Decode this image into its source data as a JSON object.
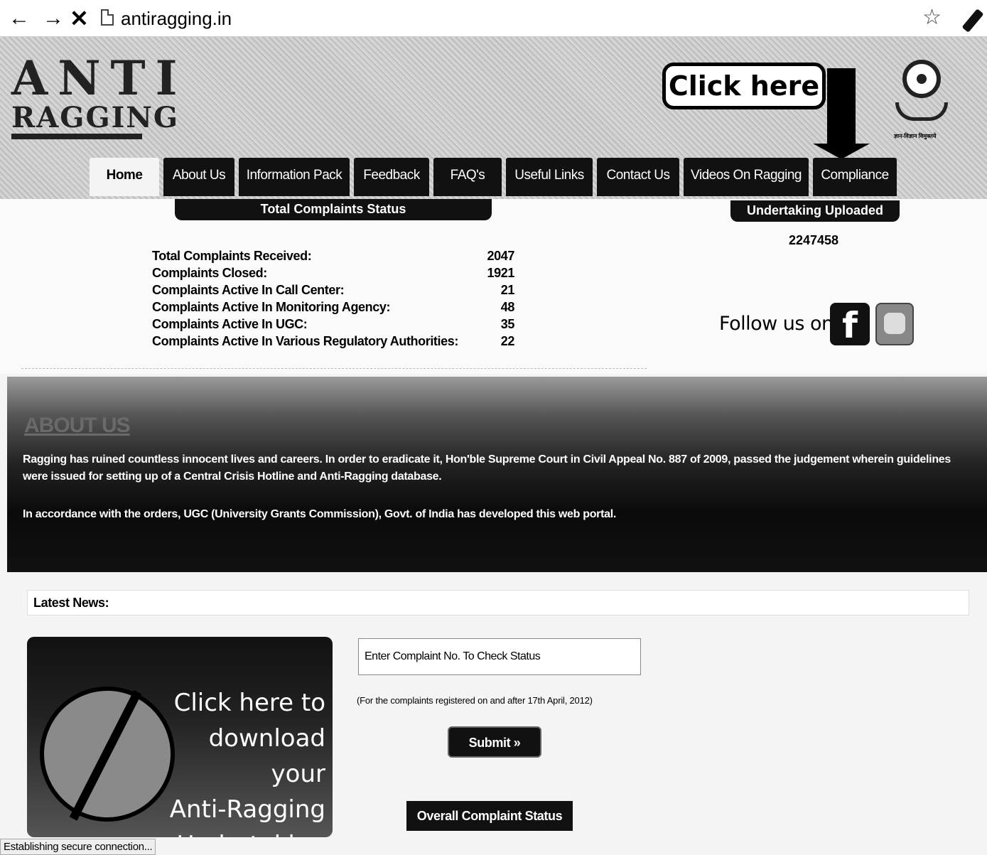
{
  "browser": {
    "url": "antiragging.in",
    "status_text": "Establishing secure connection..."
  },
  "header": {
    "logo_line1": "ANTI",
    "logo_line2": "RAGGING",
    "callout": "Click here",
    "emblem_caption": "ज्ञान-विज्ञान विमुक्तये"
  },
  "menu": [
    "Home",
    "About Us",
    "Information Pack",
    "Feedback",
    "FAQ's",
    "Useful Links",
    "Contact Us",
    "Videos On Ragging",
    "Compliance"
  ],
  "status": {
    "tab_total": "Total Complaints Status",
    "tab_undertaking": "Undertaking Uploaded",
    "undertaking_count": "2247458",
    "rows": [
      {
        "label": "Total Complaints Received:",
        "value": "2047"
      },
      {
        "label": "Complaints Closed:",
        "value": "1921"
      },
      {
        "label": "Complaints Active In Call Center:",
        "value": "21"
      },
      {
        "label": "Complaints Active In Monitoring Agency:",
        "value": "48"
      },
      {
        "label": "Complaints Active In UGC:",
        "value": "35"
      },
      {
        "label": "Complaints Active In Various Regulatory Authorities:",
        "value": "22"
      }
    ],
    "follow_text": "Follow us on",
    "facebook_glyph": "f"
  },
  "about": {
    "title": "ABOUT US",
    "p1": "Ragging has ruined countless innocent lives and careers. In order to eradicate it, Hon'ble Supreme Court in Civil Appeal No. 887 of 2009, passed the judgement wherein guidelines were issued for setting up of a Central Crisis Hotline and Anti-Ragging database.",
    "p2": "In accordance with the orders, UGC (University Grants Commission), Govt. of India has developed this web portal."
  },
  "news": {
    "label": "Latest News:"
  },
  "download": {
    "line1": "Click here to",
    "line2": "download your",
    "line3": "Anti-Ragging",
    "line4": "Undertaking"
  },
  "complaint": {
    "placeholder": "Enter Complaint No. To Check Status",
    "note": "(For the complaints registered on and after 17th April, 2012)",
    "submit_label": "Submit »",
    "overall_label": "Overall Complaint Status"
  },
  "colors": {
    "menu_bg": "#111111",
    "page_bg": "#f4f4f4"
  },
  "icons": [
    "back-arrow-icon",
    "forward-arrow-icon",
    "stop-icon",
    "page-icon",
    "star-icon",
    "eyedropper-icon",
    "facebook-icon",
    "twitter-icon",
    "ugc-emblem-icon"
  ]
}
